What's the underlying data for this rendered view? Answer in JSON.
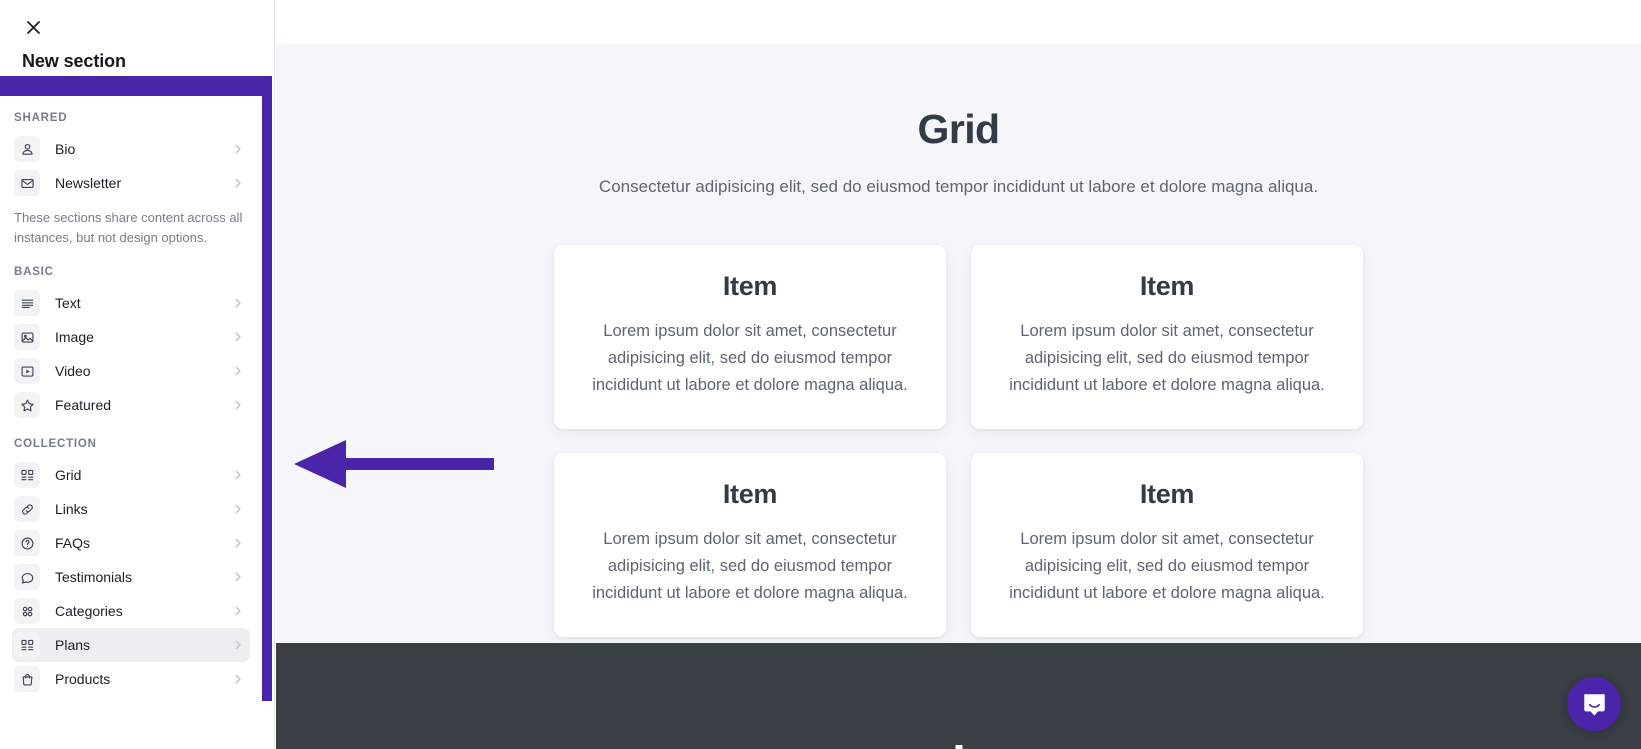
{
  "panel": {
    "close_icon": "close-icon",
    "title": "New section",
    "groups": [
      {
        "label": "SHARED",
        "items": [
          {
            "icon": "person-icon",
            "label": "Bio"
          },
          {
            "icon": "envelope-icon",
            "label": "Newsletter"
          }
        ],
        "note": "These sections share content across all instances, but not design options."
      },
      {
        "label": "BASIC",
        "items": [
          {
            "icon": "text-lines-icon",
            "label": "Text"
          },
          {
            "icon": "image-icon",
            "label": "Image"
          },
          {
            "icon": "video-play-icon",
            "label": "Video"
          },
          {
            "icon": "star-icon",
            "label": "Featured"
          }
        ],
        "note": ""
      },
      {
        "label": "COLLECTION",
        "items": [
          {
            "icon": "grid-list-icon",
            "label": "Grid"
          },
          {
            "icon": "link-chain-icon",
            "label": "Links"
          },
          {
            "icon": "question-circle-icon",
            "label": "FAQs"
          },
          {
            "icon": "speech-bubble-icon",
            "label": "Testimonials"
          },
          {
            "icon": "four-dots-icon",
            "label": "Categories"
          },
          {
            "icon": "grid-list-icon",
            "label": "Plans",
            "hovered": true
          },
          {
            "icon": "bag-icon",
            "label": "Products"
          }
        ],
        "note": ""
      }
    ]
  },
  "preview": {
    "heading": "Grid",
    "subheading": "Consectetur adipisicing elit, sed do eiusmod tempor incididunt ut labore et dolore magna aliqua.",
    "cards": [
      {
        "title": "Item",
        "text": "Lorem ipsum dolor sit amet, consectetur adipisicing elit, sed do eiusmod tempor incididunt ut labore et dolore magna aliqua."
      },
      {
        "title": "Item",
        "text": "Lorem ipsum dolor sit amet, consectetur adipisicing elit, sed do eiusmod tempor incididunt ut labore et dolore magna aliqua."
      },
      {
        "title": "Item",
        "text": "Lorem ipsum dolor sit amet, consectetur adipisicing elit, sed do eiusmod tempor incididunt ut labore et dolore magna aliqua."
      },
      {
        "title": "Item",
        "text": "Lorem ipsum dolor sit amet, consectetur adipisicing elit, sed do eiusmod tempor incididunt ut labore et dolore magna aliqua."
      }
    ]
  },
  "annotation": {
    "arrow_icon": "left-arrow-annotation",
    "arrow_color": "#4a25aa",
    "highlight_color": "#4a25aa"
  },
  "intercom": {
    "icon": "messenger-bubble-icon",
    "color": "#4a25aa"
  },
  "colors": {
    "accent": "#4a25aa",
    "preview_bg": "#f5f6fa",
    "footer_bg": "#3a3e45",
    "heading": "#333b47",
    "body_text": "#5d6571"
  }
}
